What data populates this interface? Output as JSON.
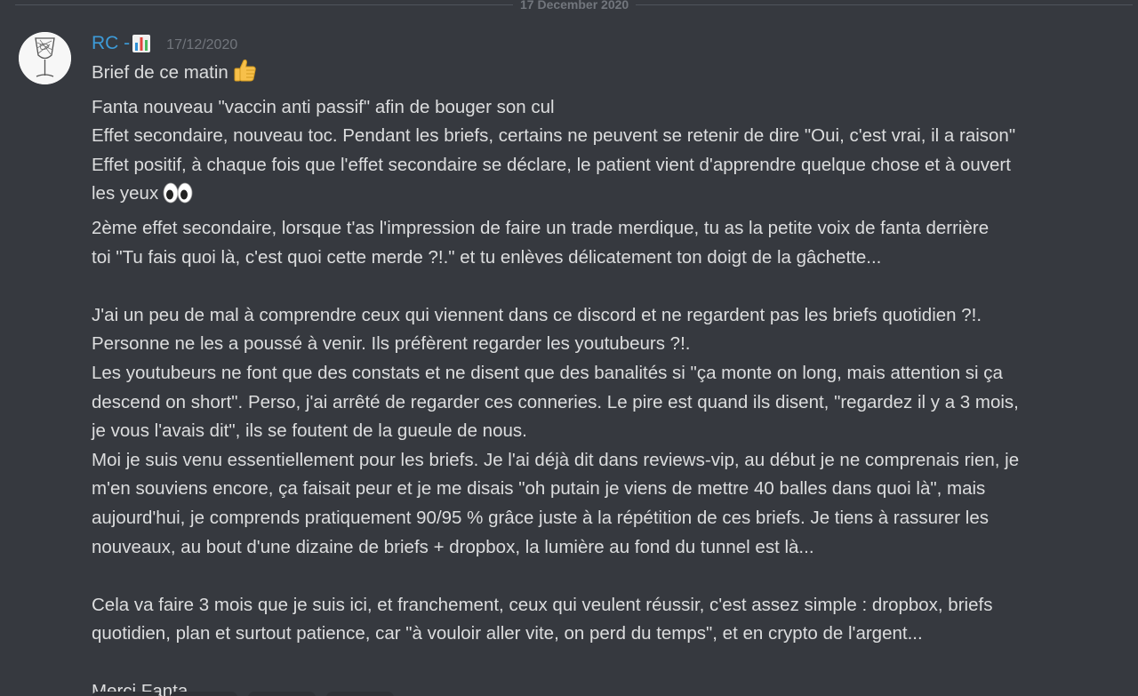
{
  "divider": {
    "date_label": "17 December 2020"
  },
  "message": {
    "author": "RC - ",
    "author_icon": "bar-chart-icon",
    "timestamp": "17/12/2020",
    "avatar_icon": "cocktail-glass-icon",
    "emojis": {
      "thumbs_up": "thumbs-up-icon",
      "eyes": "eyes-icon"
    },
    "lines": [
      "Brief de ce matin",
      "Fanta nouveau \"vaccin anti passif\" afin de bouger son cul",
      "Effet secondaire, nouveau toc. Pendant les briefs, certains ne peuvent se retenir de dire \"Oui, c'est vrai, il a raison\"",
      "Effet positif, à chaque fois que l'effet secondaire se déclare, le patient vient d'apprendre quelque chose et à ouvert",
      "les yeux",
      "2ème effet secondaire, lorsque t'as l'impression de faire un trade merdique, tu as la petite voix de fanta derrière",
      "toi \"Tu fais quoi là, c'est quoi cette merde ?!.\" et tu enlèves délicatement ton doigt de la gâchette...",
      "",
      "J'ai un peu de mal à comprendre ceux qui viennent dans ce discord et ne regardent pas les briefs quotidien ?!.",
      "Personne ne les a poussé à venir. Ils préfèrent regarder les youtubeurs ?!.",
      "Les youtubeurs ne font que des constats et ne disent que des banalités si \"ça monte on long, mais attention si ça",
      "descend on short\". Perso, j'ai arrêté de regarder ces conneries. Le pire est quand ils disent, \"regardez il y a 3 mois,",
      "je vous l'avais dit\", ils se foutent de la gueule de nous.",
      "Moi je suis venu essentiellement pour les briefs. Je l'ai déjà dit dans reviews-vip, au début je ne comprenais rien, je",
      "m'en souviens encore, ça faisait peur et je me disais \"oh putain je viens de mettre 40 balles dans quoi là\", mais",
      "aujourd'hui, je comprends pratiquement 90/95 % grâce juste à la répétition de ces briefs. Je tiens à rassurer les",
      "nouveaux, au bout d'une dizaine de briefs + dropbox, la lumière au fond du tunnel est là...",
      "",
      "Cela va faire 3 mois que je suis ici, et franchement, ceux qui veulent réussir, c'est assez simple : dropbox, briefs",
      "quotidien, plan et surtout patience, car \"à vouloir aller vite, on perd du temps\", et en crypto de l'argent...",
      "",
      "Merci Fanta"
    ]
  }
}
